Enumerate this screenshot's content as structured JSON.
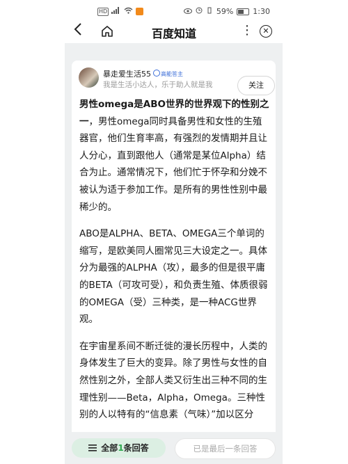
{
  "status_bar": {
    "left_icons": [
      "HD",
      "4G-signal",
      "wifi",
      "app-notification"
    ],
    "battery": "59%",
    "time": "1:30"
  },
  "nav": {
    "title": "百度知道"
  },
  "author": {
    "name": "暴走爱生活55",
    "badge": "高能答主",
    "description": "我是生活小达人，乐于助人就是我",
    "follow_label": "关注"
  },
  "article": {
    "p1_bold": "男性omega是ABO世界的世界观下的性别之一",
    "p1_rest": "，男性omega同时具备男性和女性的生殖器官，他们生育率高，有强烈的发情期并且让人分心，直到跟他人（通常是某位Alpha）结合为止。通常情况下，他们忙于怀孕和分娩不被认为适于参加工作。是所有的男性性别中最稀少的。",
    "p2": "ABO是ALPHA、BETA、OMEGA三个单词的缩写，是欧美同人圈常见三大设定之一。具体分为最强的ALPHA（攻），最多的但是很平庸的BETA（可攻可受），和负责生殖、体质很弱的OMEGA（受）三种类，是一种ACG世界观。",
    "p3": "在宇宙星系间不断迁徙的漫长历程中，人类的身体发生了巨大的变异。除了男性与女性的自然性别之外，全部人类又衍生出三种不同的生理性别——Beta，Alpha，Omega。三种性别的人以特有的“信息素（气味）”加以区分"
  },
  "bottom": {
    "all_prefix": "全部",
    "all_count": "1",
    "all_suffix": "条回答",
    "last_label": "已是最后一条回答"
  },
  "colors": {
    "accent_green": "#2fa84f",
    "badge_blue": "#3b6dd8",
    "page_bg": "#eef0f1"
  }
}
